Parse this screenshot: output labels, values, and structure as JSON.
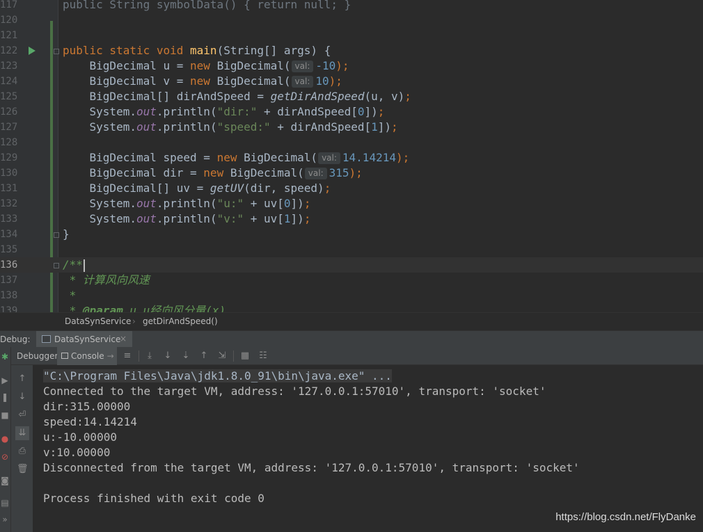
{
  "editor": {
    "lines": [
      {
        "num": "117",
        "segments": [
          {
            "t": "public String symbolData() { return null; }",
            "c": "dim"
          }
        ]
      },
      {
        "num": "120",
        "segments": []
      },
      {
        "num": "121",
        "segments": []
      },
      {
        "num": "122",
        "run": true,
        "fold": true,
        "segments": [
          {
            "t": "public static void ",
            "c": "kw"
          },
          {
            "t": "main",
            "c": "fn"
          },
          {
            "t": "(String[] args) {",
            "c": ""
          }
        ]
      },
      {
        "num": "123",
        "segments": [
          {
            "t": "    BigDecimal u = ",
            "c": ""
          },
          {
            "t": "new ",
            "c": "kw"
          },
          {
            "t": "BigDecimal(",
            "c": ""
          },
          {
            "t": "val:",
            "c": "hint"
          },
          {
            "t": "-10",
            "c": "num"
          },
          {
            "t": ");",
            "c": "kw"
          }
        ]
      },
      {
        "num": "124",
        "segments": [
          {
            "t": "    BigDecimal v = ",
            "c": ""
          },
          {
            "t": "new ",
            "c": "kw"
          },
          {
            "t": "BigDecimal(",
            "c": ""
          },
          {
            "t": "val:",
            "c": "hint"
          },
          {
            "t": "10",
            "c": "num"
          },
          {
            "t": ");",
            "c": "kw"
          }
        ]
      },
      {
        "num": "125",
        "segments": [
          {
            "t": "    BigDecimal[] dirAndSpeed = ",
            "c": ""
          },
          {
            "t": "getDirAndSpeed",
            "c": "sm"
          },
          {
            "t": "(u, v)",
            "c": ""
          },
          {
            "t": ";",
            "c": "kw"
          }
        ]
      },
      {
        "num": "126",
        "segments": [
          {
            "t": "    System.",
            "c": ""
          },
          {
            "t": "out",
            "c": "fld"
          },
          {
            "t": ".println(",
            "c": ""
          },
          {
            "t": "\"dir:\"",
            "c": "str"
          },
          {
            "t": " + dirAndSpeed[",
            "c": ""
          },
          {
            "t": "0",
            "c": "num"
          },
          {
            "t": "])",
            "c": ""
          },
          {
            "t": ";",
            "c": "kw"
          }
        ]
      },
      {
        "num": "127",
        "segments": [
          {
            "t": "    System.",
            "c": ""
          },
          {
            "t": "out",
            "c": "fld"
          },
          {
            "t": ".println(",
            "c": ""
          },
          {
            "t": "\"speed:\"",
            "c": "str"
          },
          {
            "t": " + dirAndSpeed[",
            "c": ""
          },
          {
            "t": "1",
            "c": "num"
          },
          {
            "t": "])",
            "c": ""
          },
          {
            "t": ";",
            "c": "kw"
          }
        ]
      },
      {
        "num": "128",
        "segments": []
      },
      {
        "num": "129",
        "segments": [
          {
            "t": "    BigDecimal speed = ",
            "c": ""
          },
          {
            "t": "new ",
            "c": "kw"
          },
          {
            "t": "BigDecimal(",
            "c": ""
          },
          {
            "t": "val:",
            "c": "hint"
          },
          {
            "t": "14.14214",
            "c": "num"
          },
          {
            "t": ");",
            "c": "kw"
          }
        ]
      },
      {
        "num": "130",
        "segments": [
          {
            "t": "    BigDecimal dir = ",
            "c": ""
          },
          {
            "t": "new ",
            "c": "kw"
          },
          {
            "t": "BigDecimal(",
            "c": ""
          },
          {
            "t": "val:",
            "c": "hint"
          },
          {
            "t": "315",
            "c": "num"
          },
          {
            "t": ");",
            "c": "kw"
          }
        ]
      },
      {
        "num": "131",
        "segments": [
          {
            "t": "    BigDecimal[] uv = ",
            "c": ""
          },
          {
            "t": "getUV",
            "c": "sm"
          },
          {
            "t": "(dir, speed)",
            "c": ""
          },
          {
            "t": ";",
            "c": "kw"
          }
        ]
      },
      {
        "num": "132",
        "segments": [
          {
            "t": "    System.",
            "c": ""
          },
          {
            "t": "out",
            "c": "fld"
          },
          {
            "t": ".println(",
            "c": ""
          },
          {
            "t": "\"u:\"",
            "c": "str"
          },
          {
            "t": " + uv[",
            "c": ""
          },
          {
            "t": "0",
            "c": "num"
          },
          {
            "t": "])",
            "c": ""
          },
          {
            "t": ";",
            "c": "kw"
          }
        ]
      },
      {
        "num": "133",
        "segments": [
          {
            "t": "    System.",
            "c": ""
          },
          {
            "t": "out",
            "c": "fld"
          },
          {
            "t": ".println(",
            "c": ""
          },
          {
            "t": "\"v:\"",
            "c": "str"
          },
          {
            "t": " + uv[",
            "c": ""
          },
          {
            "t": "1",
            "c": "num"
          },
          {
            "t": "])",
            "c": ""
          },
          {
            "t": ";",
            "c": "kw"
          }
        ]
      },
      {
        "num": "134",
        "fold": true,
        "segments": [
          {
            "t": "}",
            "c": ""
          }
        ]
      },
      {
        "num": "135",
        "segments": []
      },
      {
        "num": "136",
        "current": true,
        "fold": true,
        "caret": true,
        "segments": [
          {
            "t": "/**",
            "c": "doc"
          }
        ]
      },
      {
        "num": "137",
        "segments": [
          {
            "t": " * 计算风向风速",
            "c": "doc"
          }
        ]
      },
      {
        "num": "138",
        "segments": [
          {
            "t": " *",
            "c": "doc"
          }
        ]
      },
      {
        "num": "139",
        "segments": [
          {
            "t": " * ",
            "c": "doc"
          },
          {
            "t": "@param",
            "c": "tag"
          },
          {
            "t": " u u经向风分量(x)",
            "c": "doc"
          }
        ]
      }
    ]
  },
  "breadcrumb": {
    "class_name": "DataSynService",
    "method_name": "getDirAndSpeed()"
  },
  "debug": {
    "label": "Debug:",
    "session_tab": "DataSynService",
    "tabs": {
      "debugger": "Debugger",
      "console": "Console"
    }
  },
  "console": {
    "lines": [
      "\"C:\\Program Files\\Java\\jdk1.8.0_91\\bin\\java.exe\" ...",
      "Connected to the target VM, address: '127.0.0.1:57010', transport: 'socket'",
      "dir:315.00000",
      "speed:14.14214",
      "u:-10.00000",
      "v:10.00000",
      "Disconnected from the target VM, address: '127.0.0.1:57010', transport: 'socket'",
      "",
      "Process finished with exit code 0"
    ]
  },
  "watermark": "https://blog.csdn.net/FlyDanke"
}
